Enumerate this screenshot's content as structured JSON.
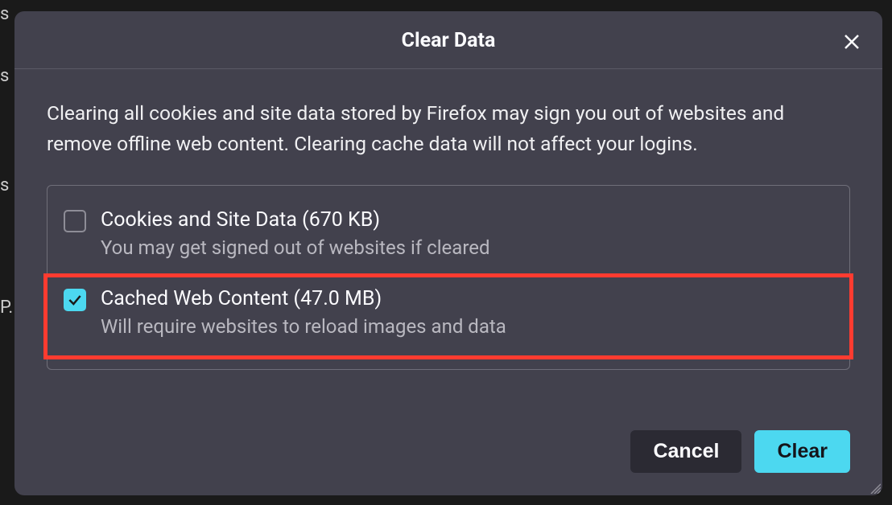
{
  "dialog": {
    "title": "Clear Data",
    "description": "Clearing all cookies and site data stored by Firefox may sign you out of websites and remove offline web content. Clearing cache data will not affect your logins."
  },
  "options": {
    "cookies": {
      "label": "Cookies and Site Data (670 KB)",
      "sublabel": "You may get signed out of websites if cleared",
      "checked": false
    },
    "cache": {
      "label": "Cached Web Content (47.0 MB)",
      "sublabel": "Will require websites to reload images and data",
      "checked": true
    }
  },
  "buttons": {
    "cancel": "Cancel",
    "clear": "Clear"
  },
  "background": {
    "hint1": "s",
    "hint2": "s",
    "hint3": "s",
    "hint4": "P."
  }
}
